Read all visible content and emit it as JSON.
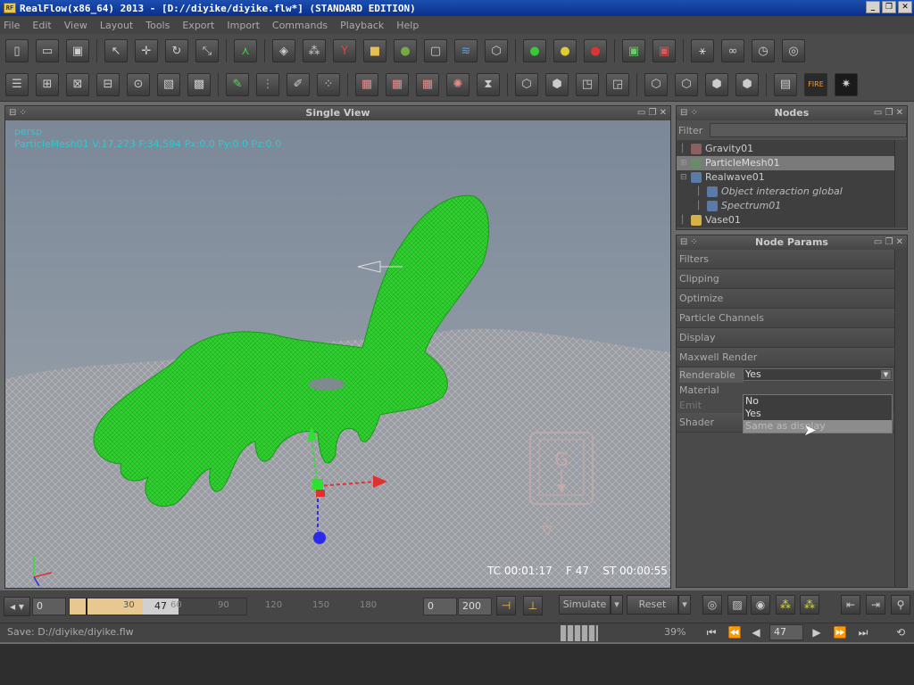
{
  "window": {
    "title": "RealFlow(x86_64) 2013 - [D://diyike/diyike.flw*] (STANDARD EDITION)",
    "app_icon": "RF"
  },
  "menu": [
    "File",
    "Edit",
    "View",
    "Layout",
    "Tools",
    "Export",
    "Import",
    "Commands",
    "Playback",
    "Help"
  ],
  "viewport": {
    "title": "Single View",
    "camera": "persp",
    "object_info": "ParticleMesh01 V:17,273 F:34,594 Px:0.0 Py:0.0 Pz:0.0",
    "tc": "TC 00:01:17",
    "frame": "F 47",
    "st": "ST 00:00:55"
  },
  "nodes_panel": {
    "title": "Nodes",
    "filter_label": "Filter",
    "items": [
      {
        "label": "Gravity01",
        "indent": 1,
        "icon_color": "#8a6060"
      },
      {
        "label": "ParticleMesh01",
        "indent": 1,
        "icon_color": "#6a8a6a",
        "selected": true,
        "expander": "+"
      },
      {
        "label": "Realwave01",
        "indent": 1,
        "icon_color": "#5b7aa8",
        "expander": "-"
      },
      {
        "label": "Object interaction global",
        "indent": 2,
        "icon_color": "#5b7aa8",
        "italic": true
      },
      {
        "label": "Spectrum01",
        "indent": 2,
        "icon_color": "#5b7aa8",
        "italic": true
      },
      {
        "label": "Vase01",
        "indent": 1,
        "icon_color": "#d8b048"
      }
    ]
  },
  "params_panel": {
    "title": "Node Params",
    "sections": [
      "Filters",
      "Clipping",
      "Optimize",
      "Particle Channels",
      "Display",
      "Maxwell Render"
    ],
    "renderable_label": "Renderable",
    "renderable_value": "Yes",
    "material_label": "Material",
    "emit_label": "Emit",
    "shader_label": "Shader",
    "dropdown_options": [
      "No",
      "Yes",
      "Same as display"
    ]
  },
  "timeline": {
    "start": "0",
    "current": "47",
    "ticks": [
      "0",
      "30",
      "60",
      "90",
      "120",
      "150",
      "180"
    ],
    "range_start": "0",
    "range_end": "200",
    "simulate_label": "Simulate",
    "reset_label": "Reset",
    "frame_field": "47",
    "percent": "39%"
  },
  "status": {
    "text": "Save: D://diyike/diyike.flw"
  },
  "colors": {
    "mesh": "#2ecf2e",
    "accent": "#30c8d0",
    "title_bg": "#0a2f8a"
  }
}
